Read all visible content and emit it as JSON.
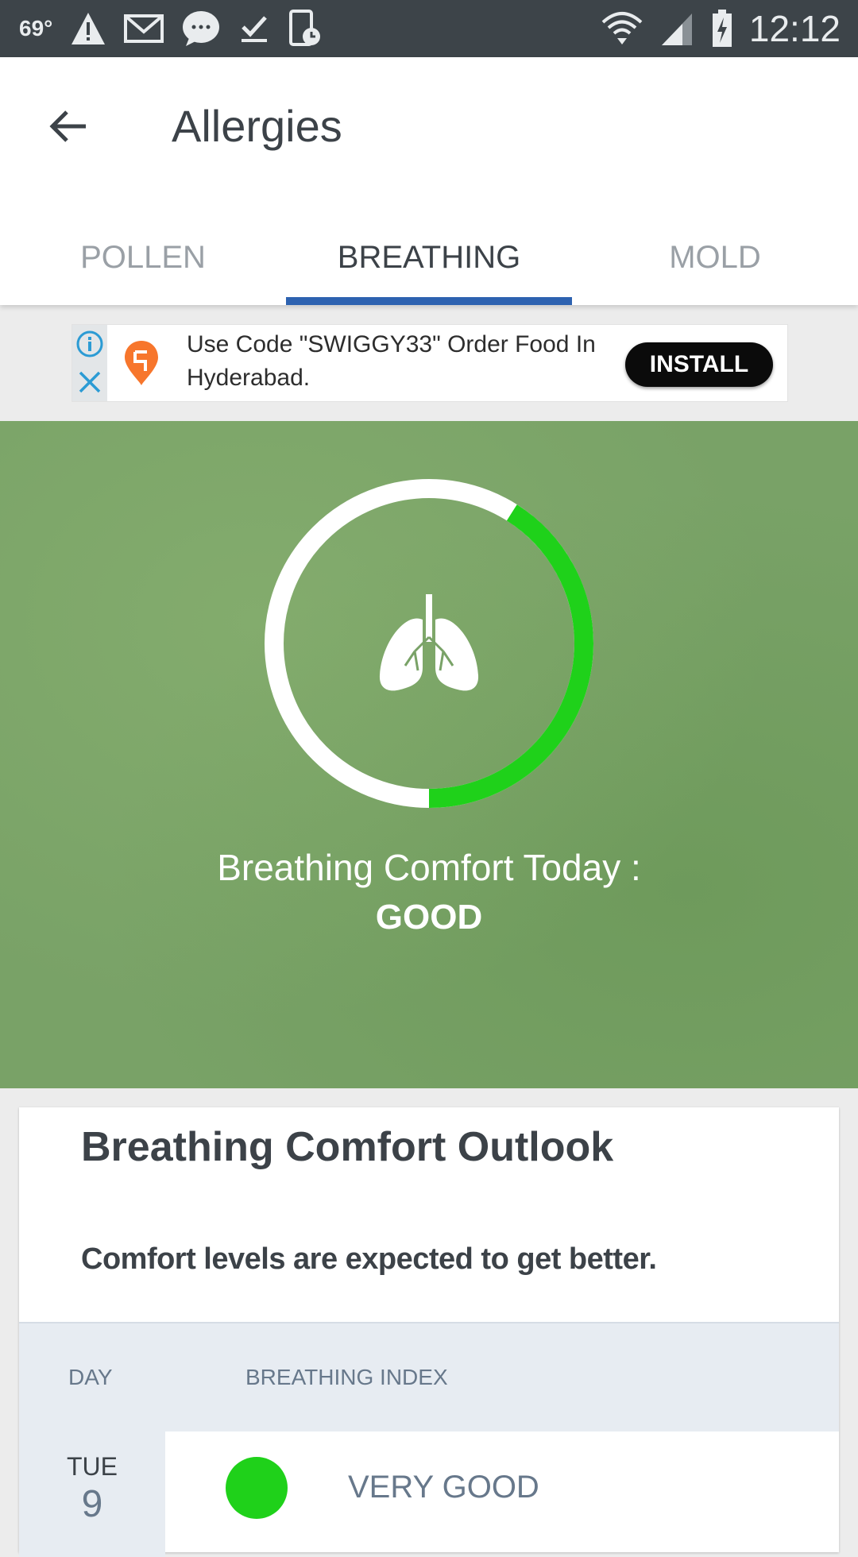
{
  "status_bar": {
    "temperature": "69°",
    "time": "12:12",
    "icons": [
      "alert-icon",
      "gmail-icon",
      "messenger-icon",
      "download-done-icon",
      "phone-clock-icon",
      "wifi-icon",
      "signal-icon",
      "battery-charging-icon"
    ]
  },
  "header": {
    "title": "Allergies",
    "back_icon": "arrow-left-icon"
  },
  "tabs": [
    {
      "label": "POLLEN",
      "active": false
    },
    {
      "label": "BREATHING",
      "active": true
    },
    {
      "label": "MOLD",
      "active": false
    }
  ],
  "ad": {
    "text": "Use Code \"SWIGGY33\" Order Food In Hyderabad.",
    "button": "INSTALL",
    "icons": [
      "info-icon",
      "close-icon",
      "swiggy-logo-icon"
    ]
  },
  "breathing": {
    "label": "Breathing Comfort Today :",
    "value": "GOOD",
    "gauge_fraction": 0.41,
    "gauge_color": "#1fd11a",
    "icon": "lungs-icon"
  },
  "outlook": {
    "title": "Breathing Comfort Outlook",
    "subtitle": "Comfort levels are expected to get better.",
    "columns": [
      "DAY",
      "BREATHING INDEX"
    ],
    "rows": [
      {
        "day": "TUE",
        "date": "9",
        "index": "VERY GOOD",
        "color": "#1fd11a"
      }
    ]
  }
}
